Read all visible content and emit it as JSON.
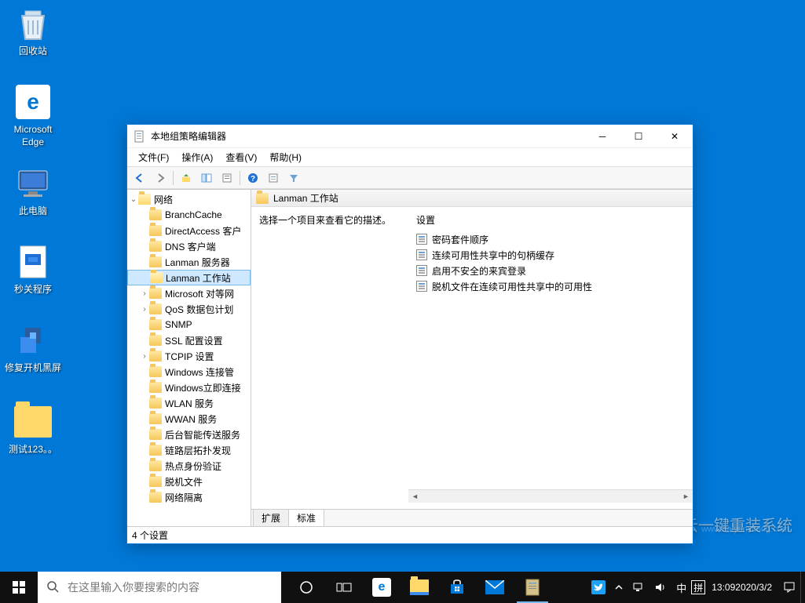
{
  "desktop_icons": {
    "recycle": "回收站",
    "edge": "Microsoft Edge",
    "computer": "此电脑",
    "shutdown": "秒关程序",
    "repair": "修复开机黑屏",
    "test": "测试123。。"
  },
  "window": {
    "title": "本地组策略编辑器",
    "menus": {
      "file": "文件(F)",
      "action": "操作(A)",
      "view": "查看(V)",
      "help": "帮助(H)"
    }
  },
  "tree": {
    "root": "网络",
    "items": [
      "BranchCache",
      "DirectAccess 客户",
      "DNS 客户端",
      "Lanman 服务器",
      "Lanman 工作站",
      "Microsoft 对等网",
      "QoS 数据包计划",
      "SNMP",
      "SSL 配置设置",
      "TCPIP 设置",
      "Windows 连接管",
      "Windows立即连接",
      "WLAN 服务",
      "WWAN 服务",
      "后台智能传送服务",
      "链路层拓扑发现",
      "热点身份验证",
      "脱机文件",
      "网络隔离"
    ],
    "selected_index": 4,
    "expanders": {
      "5": true,
      "6": true,
      "9": true
    }
  },
  "right": {
    "header": "Lanman 工作站",
    "desc": "选择一个项目来查看它的描述。",
    "settings_label": "设置",
    "settings": [
      "密码套件顺序",
      "连续可用性共享中的句柄缓存",
      "启用不安全的来宾登录",
      "脱机文件在连续可用性共享中的可用性"
    ],
    "tabs": {
      "extended": "扩展",
      "standard": "标准"
    }
  },
  "status": "4 个设置",
  "taskbar": {
    "search_placeholder": "在这里输入你要搜索的内容",
    "ime_lang": "中",
    "ime_mode": "拼",
    "time": "13:09",
    "date": "2020/3/2"
  },
  "watermark": {
    "text": "白云一键重装系统",
    "url": "www.baiyunxitong.com"
  }
}
